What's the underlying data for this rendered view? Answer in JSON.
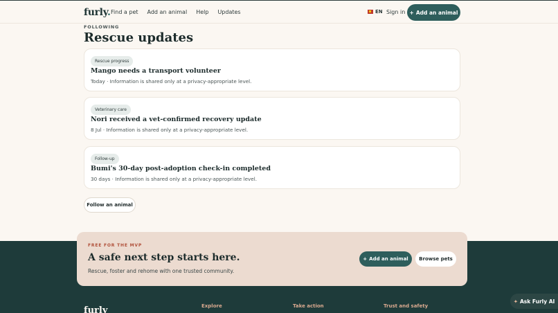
{
  "header": {
    "logo": "furly",
    "logo_dot": ".",
    "nav": [
      "Find a pet",
      "Add an animal",
      "Help",
      "Updates"
    ],
    "lang": "EN",
    "sign_in": "Sign in",
    "cta": "Add an animal",
    "cta_icon": "+"
  },
  "page": {
    "eyebrow": "FOLLOWING",
    "title": "Rescue updates"
  },
  "updates": [
    {
      "tag": "Rescue progress",
      "title": "Mango needs a transport volunteer",
      "meta": "Today · Information is shared only at a privacy-appropriate level."
    },
    {
      "tag": "Veterinary care",
      "title": "Nori received a vet-confirmed recovery update",
      "meta": "8 Jul · Information is shared only at a privacy-appropriate level."
    },
    {
      "tag": "Follow-up",
      "title": "Bumi's 30-day post-adoption check-in completed",
      "meta": "30 days · Information is shared only at a privacy-appropriate level."
    }
  ],
  "follow_button": "Follow an animal",
  "promo": {
    "eyebrow": "FREE FOR THE MVP",
    "title": "A safe next step starts here.",
    "subtitle": "Rescue, foster and rehome with one trusted community.",
    "add_label": "Add an animal",
    "add_icon": "+",
    "browse_label": "Browse pets"
  },
  "footer": {
    "logo": "furly",
    "columns": [
      "Explore",
      "Take action",
      "Trust and safety"
    ]
  },
  "assistant": {
    "label": "Ask Furly AI",
    "icon": "✦"
  },
  "colors": {
    "primary": "#2e5e5c",
    "footer_bg": "#1e3b3a",
    "promo_bg": "#ecdbd0",
    "accent": "#b0503a"
  }
}
